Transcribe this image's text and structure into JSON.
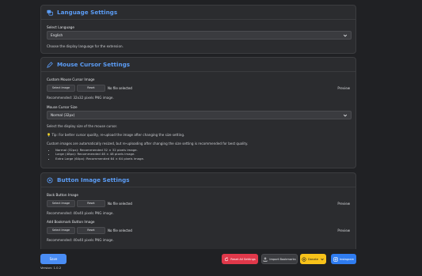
{
  "language": {
    "title": "Language Settings",
    "select_label": "Select Language",
    "selected": "English",
    "hint": "Choose the display language for the extension."
  },
  "cursor": {
    "title": "Mouse Cursor Settings",
    "image_label": "Custom Mouse Cursor Image",
    "select_image": "Select Image",
    "reset": "Reset",
    "no_file": "No file selected",
    "preview": "Preview",
    "recommended": "Recommended: 32x32 pixels PNG image.",
    "size_label": "Mouse Cursor Size",
    "size_selected": "Normal (32px)",
    "size_hint": "Select the display size of the mouse cursor.",
    "tip": "💡 Tip: For better cursor quality, re-upload the image after changing the size setting.",
    "custom_note": "Custom images are automatically resized, but re-uploading after changing the size setting is recommended for best quality.",
    "sizes": [
      "Normal (32px): Recommended 32 × 32 pixels image.",
      "Large (48px): Recommended 48 × 48 pixels image.",
      "Extra Large (64px): Recommended 64 × 64 pixels image."
    ]
  },
  "buttons": {
    "title": "Button Image Settings",
    "back_label": "Back Button Image",
    "add_label": "Add Bookmark Button Image",
    "select_image": "Select Image",
    "reset": "Reset",
    "no_file": "No file selected",
    "preview": "Preview",
    "recommended_back": "Recommended: 40x40 pixels PNG image.",
    "recommended_add": "Recommended: 40x40 pixels PNG image."
  },
  "footer": {
    "save": "Save",
    "version": "Version: 1.0.2",
    "reset_all": "Reset All Settings",
    "import": "Import Bookmarks",
    "donate": "Donate",
    "instagram": "Instagram"
  },
  "colors": {
    "accent": "#4a8df5",
    "title": "#5b9cf5",
    "danger": "#e0384a",
    "donate": "#f7c21a"
  }
}
